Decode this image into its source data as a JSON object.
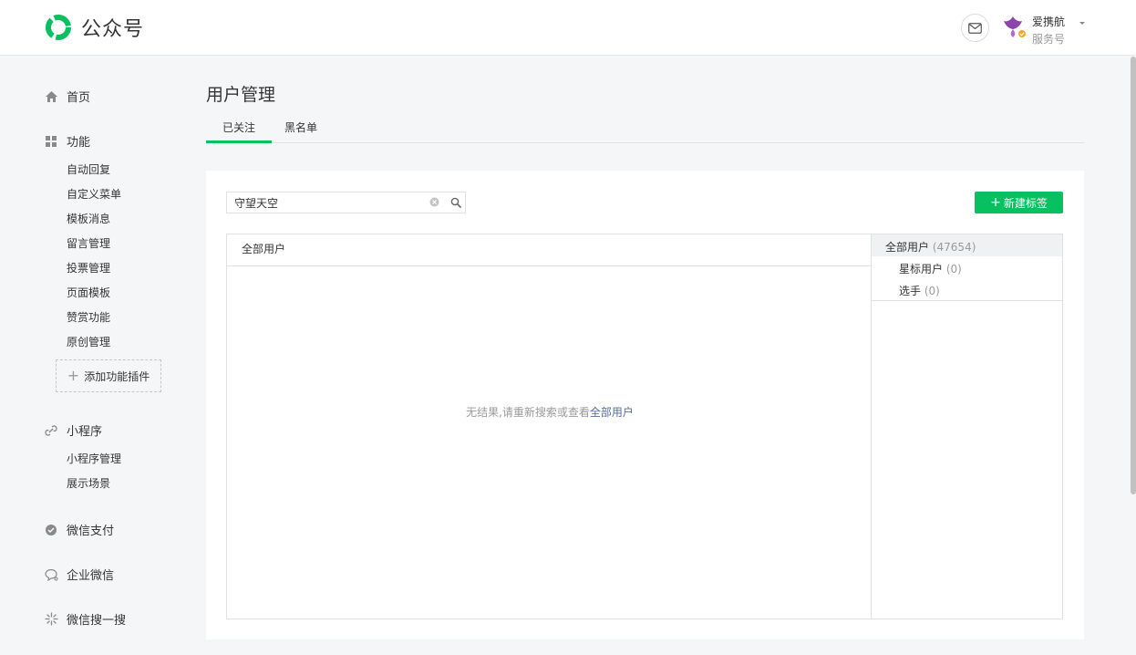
{
  "header": {
    "logo_text": "公众号",
    "account_name": "爱携航",
    "account_type": "服务号"
  },
  "sidebar": {
    "home": "首页",
    "features": {
      "label": "功能",
      "items": [
        "自动回复",
        "自定义菜单",
        "模板消息",
        "留言管理",
        "投票管理",
        "页面模板",
        "赞赏功能",
        "原创管理"
      ],
      "add_plugin": "添加功能插件"
    },
    "miniprogram": {
      "label": "小程序",
      "items": [
        "小程序管理",
        "展示场景"
      ]
    },
    "wechat_pay": "微信支付",
    "wecom": "企业微信",
    "wechat_search": "微信搜一搜"
  },
  "main": {
    "title": "用户管理",
    "tabs": [
      {
        "label": "已关注",
        "active": true
      },
      {
        "label": "黑名单",
        "active": false
      }
    ],
    "search": {
      "value": "守望天空"
    },
    "new_tag_label": "新建标签",
    "list_header": "全部用户",
    "empty": {
      "prefix": "无结果,请重新搜索或查看",
      "link": "全部用户"
    },
    "tags": [
      {
        "name": "全部用户",
        "count": "(47654)"
      },
      {
        "name": "星标用户",
        "count": "(0)"
      },
      {
        "name": "选手",
        "count": "(0)"
      }
    ]
  },
  "colors": {
    "accent": "#07c160",
    "link": "#576b95"
  }
}
